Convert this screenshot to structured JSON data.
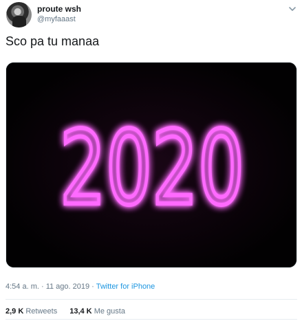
{
  "user": {
    "display_name": "proute wsh",
    "username": "@myfaaast"
  },
  "tweet": {
    "text": "Sco pa tu manaa",
    "image_text": "2020",
    "time": "4:54 a. m.",
    "date": "11 ago. 2019",
    "source": "Twitter for iPhone",
    "separator": " · "
  },
  "stats": {
    "retweets_count": "2,9 K",
    "retweets_label": "Retweets",
    "likes_count": "13,4 K",
    "likes_label": "Me gusta"
  },
  "colors": {
    "neon": "#ff6bff",
    "link": "#1b95e0",
    "muted": "#657786"
  },
  "icons": {
    "menu": "chevron-down-icon"
  }
}
